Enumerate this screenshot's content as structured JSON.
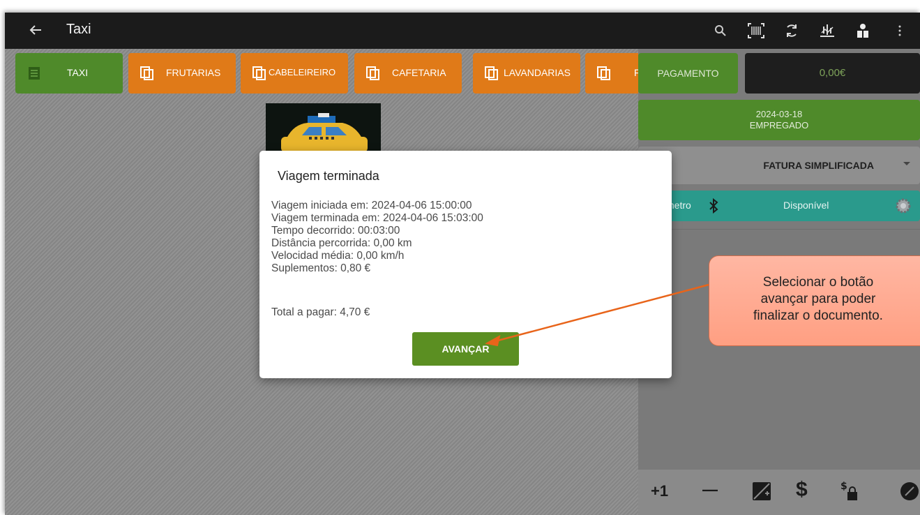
{
  "appbar": {
    "title": "Taxi",
    "icons": [
      "back-arrow-icon",
      "search-icon",
      "barcode-scan-icon",
      "sync-icon",
      "split-icon",
      "user-icon",
      "more-vert-icon"
    ]
  },
  "categories": [
    {
      "label": "TAXI",
      "color": "#4f8a2a",
      "icon": "list-icon"
    },
    {
      "label": "FRUTARIAS",
      "color": "#e07a18",
      "icon": "copy-icon"
    },
    {
      "label": "CABELEIREIRO",
      "color": "#e07a18",
      "icon": "copy-icon"
    },
    {
      "label": "CAFETARIA",
      "color": "#e07a18",
      "icon": "copy-icon"
    },
    {
      "label": "LAVANDARIAS",
      "color": "#e07a18",
      "icon": "copy-icon"
    },
    {
      "label": "F",
      "color": "#e07a18",
      "icon": "copy-icon"
    }
  ],
  "right_panel": {
    "pay_label": "PAGAMENTO",
    "total": "0,00€",
    "date": "2024-03-18",
    "employee": "EMPREGADO",
    "doc_type": "FATURA SIMPLIFICADA",
    "meter_label": "metro",
    "status": "Disponível"
  },
  "bottom_bar": {
    "plus_one": "+1",
    "minus": "—",
    "dollar": "$"
  },
  "dialog": {
    "title": "Viagem terminada",
    "lines": [
      "Viagem iniciada em: 2024-04-06 15:00:00",
      "Viagem terminada em: 2024-04-06 15:03:00",
      "Tempo decorrido: 00:03:00",
      "Distância percorrida: 0,00 km",
      "Velocidad média: 0,00 km/h",
      "Suplementos: 0,80 €"
    ],
    "total_line": "Total a pagar: 4,70 €",
    "button_label": "AVANÇAR"
  },
  "callout": {
    "line1": "Selecionar o botão",
    "line2": "avançar para poder",
    "line3": "finalizar o documento."
  },
  "colors": {
    "appbar": "#1b1b1b",
    "green": "#4f8a2a",
    "orange": "#e07a18",
    "teal": "#2a9a8c",
    "callout": "#ffa98e",
    "arrow": "#e8641a"
  }
}
